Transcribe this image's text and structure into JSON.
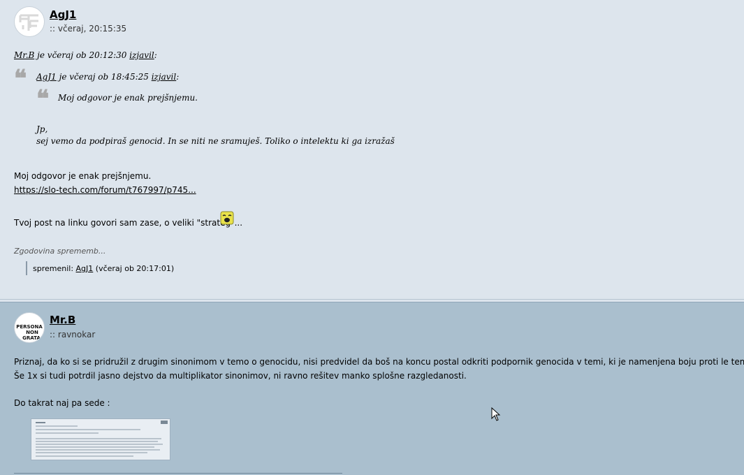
{
  "post1": {
    "username": "AgJ1",
    "timestamp": ":: včeraj, 20:15:35",
    "quote_outer": {
      "author": "Mr.B",
      "text": " je včeraj ob 20:12:30 ",
      "said": "izjavil",
      "colon": ":"
    },
    "quote_inner": {
      "author": "AgJ1",
      "text": " je včeraj ob 18:45:25 ",
      "said": "izjavil",
      "colon": ":"
    },
    "quote_nested_text": "Moj odgovor je enak prejšnjemu.",
    "quote_reply_line1": "Jp,",
    "quote_reply_line2": "sej vemo da podpiraš genocid. In se niti ne sramuješ. Toliko o intelektu ki ga izražaš",
    "body_line1": "Moj odgovor je enak prejšnjemu.",
    "body_link": "https://slo-tech.com/forum/t767997/p745...",
    "body_line2": "Tvoj post na linku govori sam zase, o veliki \"strateg\"...",
    "history_label": "Zgodovina sprememb...",
    "history_prefix": "spremenil: ",
    "history_user": "AgJ1",
    "history_suffix": " (včeraj ob 20:17:01)"
  },
  "post2": {
    "username": "Mr.B",
    "rank": ":: ravnokar",
    "avatar_text": [
      "PERSONA",
      "NON",
      "GRATA"
    ],
    "body_line1": "Priznaj, da ko si se pridružil z drugim sinonimom v temo o genocidu, nisi predvidel da boš na koncu postal odkriti podpornik genocida v temi, ki je namenjena boju proti le temu.",
    "body_line2": "Še 1x si tudi potrdil jasno dejstvo da multiplikator sinonimov, ni ravno rešitev manko splošne razgledanosti.",
    "body_line3": "Do takrat naj pa sede :"
  },
  "colors": {
    "post_bg_light": "#dde5ed",
    "post_bg_blue": "#aabfce",
    "quote_mark": "#a8a8a8"
  },
  "icons": [
    "avatar-logo-icon",
    "laughing-smiley-icon",
    "mouse-pointer-icon",
    "quote-mark-icon"
  ]
}
